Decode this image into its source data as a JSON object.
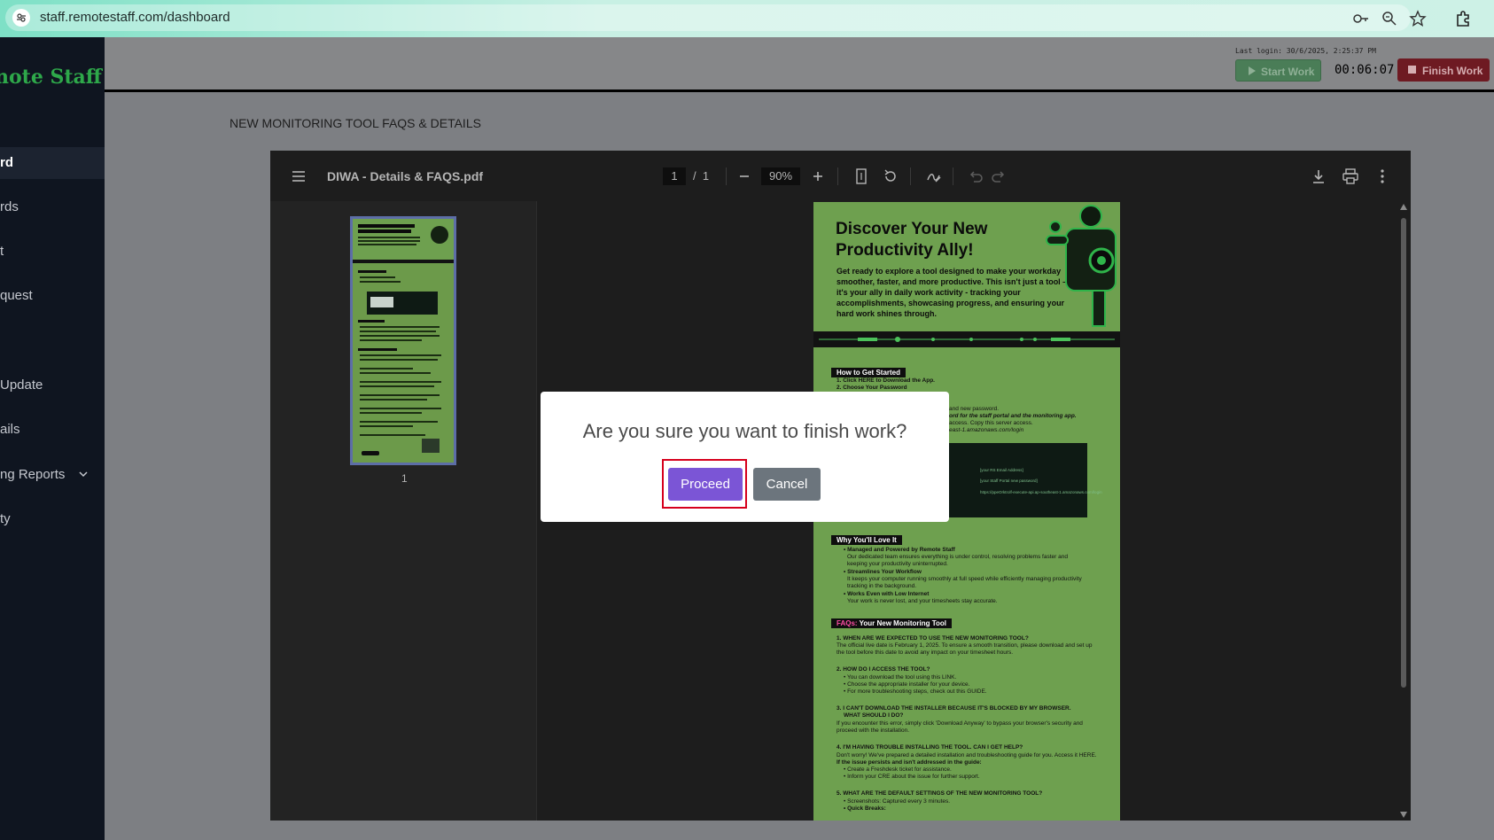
{
  "browser": {
    "url": "staff.remotestaff.com/dashboard"
  },
  "sidebar": {
    "brand": "note Staff",
    "items": [
      {
        "label": "rd",
        "active": true
      },
      {
        "label": "rds"
      },
      {
        "label": "t"
      },
      {
        "label": "quest"
      },
      {
        "label": "Update"
      },
      {
        "label": "ails"
      },
      {
        "label": "ng Reports",
        "has_submenu": true
      },
      {
        "label": "ty"
      }
    ]
  },
  "header": {
    "last_login": "Last login: 30/6/2025, 2:25:37 PM",
    "start_work_label": "Start Work",
    "timer": "00:06:07",
    "finish_work_label": "Finish Work"
  },
  "page": {
    "title": "NEW MONITORING TOOL FAQS & DETAILS"
  },
  "pdf": {
    "filename": "DIWA - Details & FAQS.pdf",
    "current_page": "1",
    "total_pages": "1",
    "zoom": "90%",
    "thumbnail_label": "1",
    "hero_title_line1": "Discover Your New",
    "hero_title_line2": "Productivity Ally!",
    "hero_body": "Get ready to explore a tool designed to make your workday smoother, faster, and more productive. This isn't just a tool – it's your ally in daily work activity - tracking your accomplishments, showcasing progress, and ensuring your hard work shines through.",
    "sec_get_started": "How to Get Started",
    "gs_line1": "1. Click HERE to Download the App.",
    "gs_line2": "2. Choose Your Password",
    "gs_line3": "and new password.",
    "gs_line4": "ord for the staff portal and the monitoring app.",
    "gs_line5": "access. Copy this server access.",
    "gs_line6": "east-1.amazonaws.com/login",
    "shot_l1": "[your RS Email Address]",
    "shot_l2": "[your Staff Portal new password]",
    "shot_l3": "https://ppeOrktrolf-execute-api.ap-southeast-1.amazonaws.com/login",
    "sec_love": "Why You'll Love It",
    "love_lines": [
      "• Managed and Powered by Remote Staff",
      "Our dedicated team ensures everything is under control, resolving problems faster and",
      "keeping your productivity uninterrupted.",
      "• Streamlines Your Workflow",
      "It keeps your computer running smoothly at full speed while efficiently managing productivity",
      "tracking in the background.",
      "• Works Even with Low Internet",
      "Your work is never lost, and your timesheets stay accurate."
    ],
    "sec_faq_a": "FAQs:",
    "sec_faq_b": " Your New Monitoring Tool",
    "faq_lines": [
      "1. WHEN ARE WE EXPECTED TO USE THE NEW MONITORING TOOL?",
      "The official live date is February 1, 2025. To ensure a smooth transition, please download and set up",
      "the tool before this date to avoid any impact on your timesheet hours.",
      "2. HOW DO I ACCESS THE TOOL?",
      "• You can download the tool using this LINK.",
      "• Choose the appropriate installer for your device.",
      "• For more troubleshooting steps, check out this GUIDE.",
      "3. I CAN'T DOWNLOAD THE INSTALLER BECAUSE IT'S BLOCKED BY MY BROWSER.",
      "WHAT SHOULD I DO?",
      "If you encounter this error, simply click 'Download Anyway' to bypass your browser's security and",
      "proceed with the installation.",
      "4. I'M HAVING TROUBLE INSTALLING THE TOOL. CAN I GET HELP?",
      "Don't worry! We've prepared a detailed installation and troubleshooting guide for you. Access it HERE.",
      "If the issue persists and isn't addressed in the guide:",
      "• Create a Freshdesk ticket for assistance.",
      "• Inform your CRE about the issue for further support.",
      "5. WHAT ARE THE DEFAULT SETTINGS OF THE NEW MONITORING TOOL?",
      "• Screenshots: Captured every 3 minutes.",
      "• Quick Breaks:"
    ]
  },
  "modal": {
    "title": "Are you sure you want to finish work?",
    "proceed_label": "Proceed",
    "cancel_label": "Cancel"
  }
}
